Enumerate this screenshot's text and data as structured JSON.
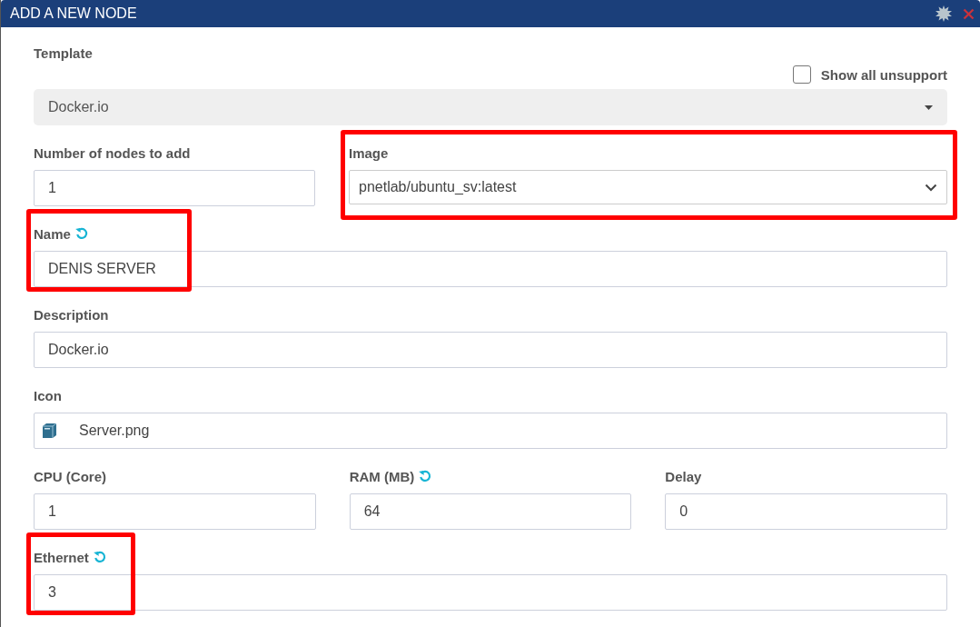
{
  "window": {
    "title": "ADD A NEW NODE"
  },
  "template": {
    "label": "Template",
    "value": "Docker.io"
  },
  "show_unsupported": {
    "label": "Show all unsupport",
    "checked": false
  },
  "rows": [
    {
      "fields": [
        {
          "kind": "text",
          "label": "Number of nodes to add",
          "value": "1",
          "resettable": false,
          "highlighted": false
        },
        {
          "kind": "select",
          "label": "Image",
          "value": "pnetlab/ubuntu_sv:latest",
          "resettable": false,
          "highlighted": true
        }
      ]
    },
    {
      "fields": [
        {
          "kind": "text",
          "label": "Name",
          "value": "DENIS SERVER",
          "resettable": true,
          "highlighted": true
        }
      ]
    },
    {
      "fields": [
        {
          "kind": "text",
          "label": "Description",
          "value": "Docker.io",
          "resettable": false,
          "highlighted": false
        }
      ]
    },
    {
      "fields": [
        {
          "kind": "icon",
          "label": "Icon",
          "value": "Server.png",
          "resettable": false,
          "highlighted": false
        }
      ]
    },
    {
      "fields": [
        {
          "kind": "text",
          "label": "CPU (Core)",
          "value": "1",
          "resettable": false,
          "highlighted": false
        },
        {
          "kind": "text",
          "label": "RAM (MB)",
          "value": "64",
          "resettable": true,
          "highlighted": false
        },
        {
          "kind": "text",
          "label": "Delay",
          "value": "0",
          "resettable": false,
          "highlighted": false
        }
      ]
    },
    {
      "fields": [
        {
          "kind": "text",
          "label": "Ethernet",
          "value": "3",
          "resettable": true,
          "highlighted": true
        }
      ]
    }
  ]
}
